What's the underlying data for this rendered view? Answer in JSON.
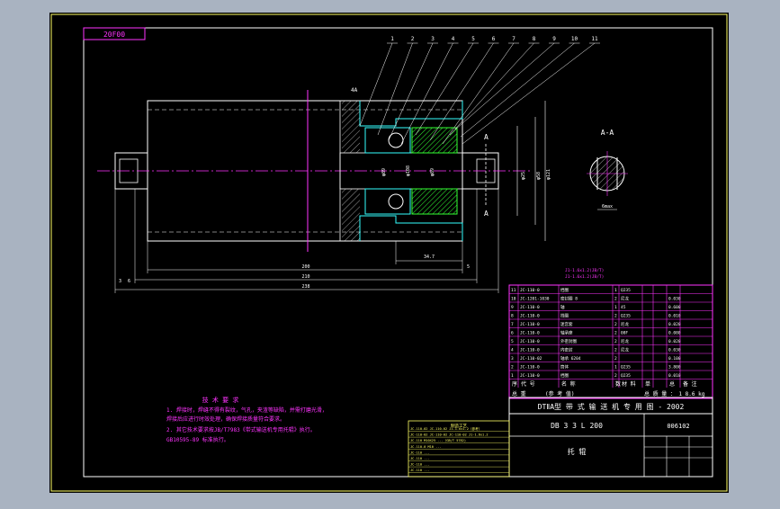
{
  "stamp_label": "20F00",
  "leader_numbers": [
    "1",
    "2",
    "3",
    "4",
    "5",
    "6",
    "7",
    "8",
    "9",
    "10",
    "11"
  ],
  "label_top_mark": "4A",
  "section_letter": "A",
  "section_title": "A-A",
  "dims": {
    "d1": "φ121",
    "d2": "φ89",
    "d3": "φ108",
    "d4": "φ89",
    "d5": "φ25",
    "d6": "φ58",
    "len_short": "34.7",
    "l1": "200",
    "l2": "210",
    "l3": "238",
    "left_a": "3",
    "left_b": "6",
    "right_a": "5",
    "key": "6max"
  },
  "notes": {
    "title": "技 术 要 求",
    "lines": [
      "1. 焊接时，焊缝不得有裂纹，气孔，夹渣等缺陷，并需打磨光滑，",
      "   焊接后应进行时效处理，确保焊接质量符合要求。",
      "2. 其它技术要求按JB/T7983《带式输送机专用托辊》执行。",
      "   GB10595-89 标准执行。"
    ]
  },
  "mid_notes": [
    "J1-1.6x1.2(JB/T)",
    "J1-1.6x1.2(JB/T)"
  ],
  "bom_rows": [
    [
      "11",
      "JC-110-0",
      "挡圈",
      "1",
      "Q235",
      "",
      "",
      "",
      "",
      "GB"
    ],
    [
      "10",
      "JC-1201-1030",
      "密封圈 8",
      "2",
      "尼龙",
      "",
      "",
      "0.030",
      "",
      "0.06"
    ],
    [
      "9",
      "JC-110-0",
      "轴",
      "1",
      "45",
      "",
      "",
      "0.600",
      "",
      "0.60"
    ],
    [
      "8",
      "JC-110-0",
      "挡圈",
      "2",
      "Q235",
      "",
      "",
      "0.010",
      "",
      "0.02"
    ],
    [
      "7",
      "JC-110-0",
      "迷宫套",
      "2",
      "尼龙",
      "",
      "",
      "0.020",
      "",
      "0.04"
    ],
    [
      "6",
      "JC-110-0",
      "轴承座",
      "2",
      "08F",
      "",
      "",
      "0.080",
      "",
      "0.16"
    ],
    [
      "5",
      "JC-110-0",
      "外密封圈",
      "2",
      "尼龙",
      "",
      "",
      "0.020",
      "",
      "0.04"
    ],
    [
      "4",
      "JC-110-0",
      "内密封",
      "2",
      "尼龙",
      "",
      "",
      "0.030",
      "",
      "0.06"
    ],
    [
      "3",
      "JC-110-02",
      "轴承 6204",
      "2",
      "",
      "",
      "",
      "0.100",
      "",
      "0.20"
    ],
    [
      "2",
      "JC-110-0",
      "筒体",
      "1",
      "Q235",
      "",
      "",
      "3.800",
      "",
      "3.80"
    ],
    [
      "1",
      "JC-110-0",
      "挡圈",
      "2",
      "Q235",
      "",
      "",
      "0.010",
      "",
      "0.02"
    ]
  ],
  "bom_header": [
    "序",
    "代 号",
    "名 称",
    "数",
    "材 料",
    "单",
    "总",
    "备 注"
  ],
  "mass_line": [
    "总 重",
    "(参 考 值)",
    "总 质 量 ： 1 8.6 kg"
  ],
  "title_main": "DTⅡA型  带 式 输 送 机 专 用 图 - 2002",
  "drawing_no": "DB 3 3 L 200",
  "drawing_no2": "006102",
  "part_name": "托 辊",
  "small_table_title": "制造工艺",
  "small_table_rows": [
    "JC-110-02 JC-110-02 J1-1.6x1.2（参考）",
    "JC-110-02 JC-110-02 JC-110-02 J1-1.6x1.2",
    "JC-110 M10X25 ...（GB/T 5782)",
    "JC-110-0 M10 ...",
    "JC-110 ...",
    "JC-110 ...",
    "JC-110 ...",
    "JC-110 ..."
  ],
  "colors": {
    "background": "#a9b3c1",
    "paper": "#000000",
    "frame": "#ffff66",
    "geometry": "#ffffff",
    "object": "#ff33ff",
    "dimension": "#ffffff",
    "hatch": "#33ff33",
    "pipe": "#33ffff",
    "table_line": "#ff33ff",
    "table_text": "#ffffff"
  }
}
